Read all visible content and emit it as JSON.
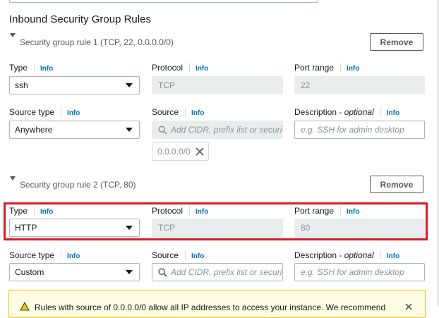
{
  "section": {
    "title": "Inbound Security Group Rules"
  },
  "common": {
    "info": "Info"
  },
  "rules": [
    {
      "title": "Security group rule 1 (TCP, 22, 0.0.0.0/0)",
      "remove_label": "Remove",
      "type_label": "Type",
      "type_value": "ssh",
      "protocol_label": "Protocol",
      "protocol_value": "TCP",
      "port_label": "Port range",
      "port_value": "22",
      "source_type_label": "Source type",
      "source_type_value": "Anywhere",
      "source_label": "Source",
      "source_placeholder": "Add CIDR, prefix list or security",
      "source_token": "0.0.0.0/0",
      "desc_label_main": "Description - ",
      "desc_label_opt": "optional",
      "desc_placeholder": "e.g. SSH for admin desktop"
    },
    {
      "title": "Security group rule 2 (TCP, 80)",
      "remove_label": "Remove",
      "type_label": "Type",
      "type_value": "HTTP",
      "protocol_label": "Protocol",
      "protocol_value": "TCP",
      "port_label": "Port range",
      "port_value": "80",
      "source_type_label": "Source type",
      "source_type_value": "Custom",
      "source_label": "Source",
      "source_placeholder": "Add CIDR, prefix list or security",
      "desc_label_main": "Description - ",
      "desc_label_opt": "optional",
      "desc_placeholder": "e.g. SSH for admin desktop"
    }
  ],
  "warning": {
    "text": "Rules with source of 0.0.0.0/0 allow all IP addresses to access your instance. We recommend"
  },
  "colors": {
    "accent_info": "#0073bb",
    "highlight": "#e0182a",
    "warning_bg": "#fffce4",
    "warning_border": "#f2c300"
  },
  "icons": [
    "caret-down-icon",
    "chevron-down-icon",
    "search-icon",
    "close-icon",
    "warning-icon"
  ]
}
